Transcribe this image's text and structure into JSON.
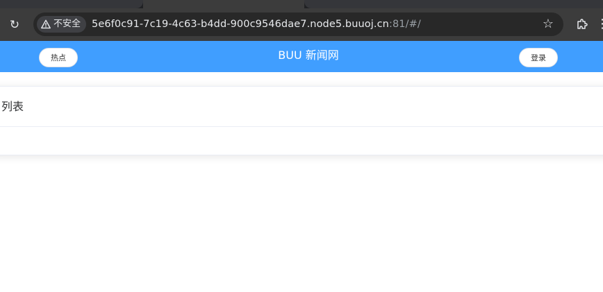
{
  "browser": {
    "security_label": "不安全",
    "url_host": "5e6f0c91-7c19-4c63-b4dd-900c9546dae7.node5.buuoj.cn",
    "url_rest": ":81/#/",
    "icons": {
      "reload": "reload-icon",
      "warning": "warning-icon",
      "bookmark": "star-icon",
      "extensions": "puzzle-icon",
      "menu": "kebab-menu-icon"
    }
  },
  "header": {
    "left_button": "热点",
    "title": "BUU 新闻网",
    "right_button": "登录",
    "bg_color": "#409eff"
  },
  "main": {
    "card_title": "列表"
  }
}
